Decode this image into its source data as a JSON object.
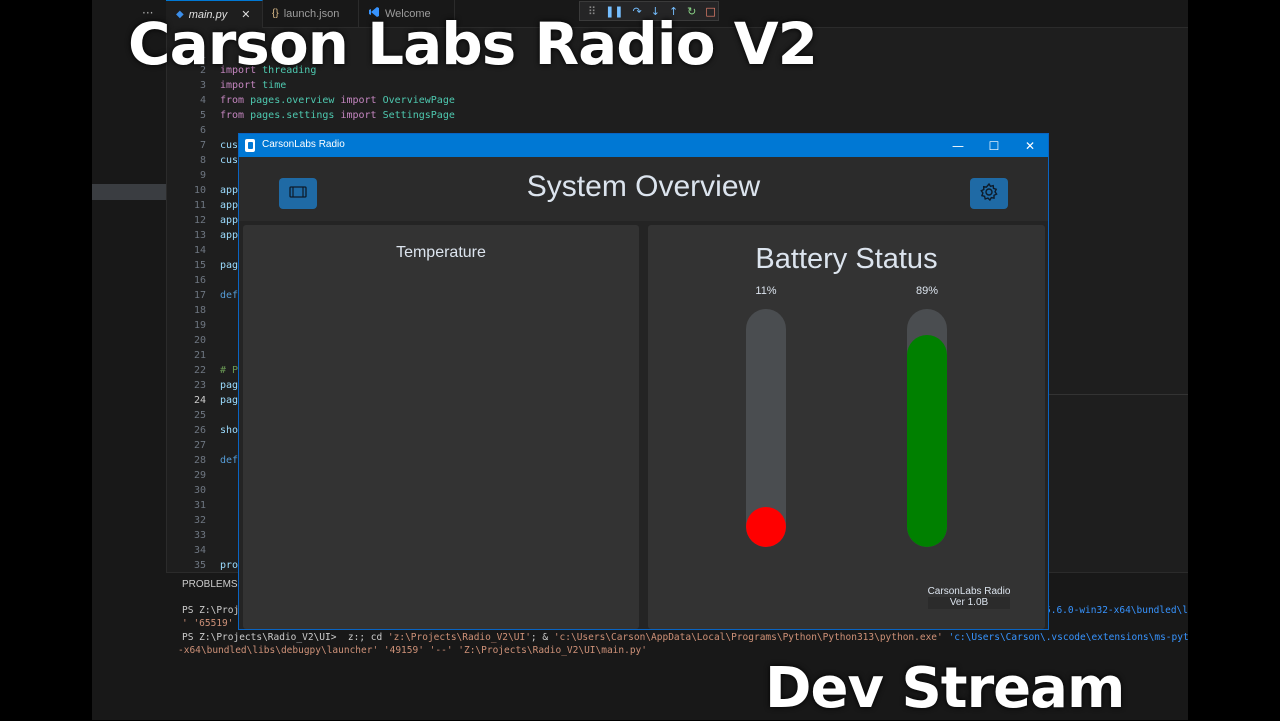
{
  "overlay": {
    "title": "Carson Labs Radio V2",
    "subtitle": "Dev Stream"
  },
  "editor": {
    "more_label": "···",
    "tabs": [
      {
        "label": "main.py",
        "icon": "python-file-icon",
        "active": true,
        "close": "✕"
      },
      {
        "label": "launch.json",
        "icon": "json-file-icon",
        "active": false
      },
      {
        "label": "Welcome",
        "icon": "vscode-logo-icon",
        "active": false
      }
    ],
    "line_numbers": [
      "1",
      "2",
      "3",
      "4",
      "5",
      "6",
      "7",
      "8",
      "9",
      "10",
      "11",
      "12",
      "13",
      "14",
      "15",
      "16",
      "17",
      "18",
      "19",
      "20",
      "21",
      "22",
      "23",
      "24",
      "25",
      "26",
      "27",
      "28",
      "29",
      "30",
      "31",
      "32",
      "33",
      "34",
      "35"
    ],
    "current_line": "24",
    "code": {
      "l2_kw": "import",
      "l2_mod": "threading",
      "l3_kw": "import",
      "l3_mod": "time",
      "l4_from": "from",
      "l4_mod": "pages.overview",
      "l4_imp": "import",
      "l4_name": "OverviewPage",
      "l5_from": "from",
      "l5_mod": "pages.settings",
      "l5_imp": "import",
      "l5_name": "SettingsPage",
      "l7": "cus",
      "l8": "cus",
      "l10": "app",
      "l11": "app",
      "l12": "app",
      "l13": "app",
      "l15": "pag",
      "l17": "def",
      "l22": "# P",
      "l23": "pag",
      "l24": "pag",
      "l26": "sho",
      "l28": "def",
      "l35": "pro"
    },
    "panel": {
      "title": "PROBLEMS",
      "line1_prefix": "PS Z:\\Proje",
      "line1_right": "25.6.0-win32-x64\\bundled\\l",
      "line2": "' '65519'",
      "line3_prompt": "PS Z:\\Projects\\Radio_V2\\UI>",
      "line3_cmd": "  z:; cd ",
      "line3_s1": "'z:\\Projects\\Radio_V2\\UI'",
      "line3_mid": "; & ",
      "line3_s2": "'c:\\Users\\Carson\\AppData\\Local\\Programs\\Python\\Python313\\python.exe'",
      "line3_s3": " 'c:\\Users\\Carson\\.vscode\\extensions\\ms-python.de",
      "line4": "-x64\\bundled\\libs\\debugpy\\launcher' '49159' '--' 'Z:\\Projects\\Radio_V2\\UI\\main.py'"
    }
  },
  "window": {
    "title": "CarsonLabs Radio",
    "minimize": "—",
    "maximize": "☐",
    "close": "✕",
    "page_title": "System Overview",
    "left_button_icon": "film-icon",
    "right_button_icon": "gear-icon",
    "temperature": {
      "label": "Temperature"
    },
    "battery": {
      "title": "Battery Status",
      "bars": [
        {
          "label": "11%",
          "level": 0.11,
          "color": "#ff0000"
        },
        {
          "label": "89%",
          "level": 0.89,
          "color": "#008000"
        }
      ]
    },
    "app_name": "CarsonLabs Radio",
    "version": "Ver 1.0B"
  },
  "colors": {
    "accent": "#1f6aa5",
    "titlebar": "#0078d4",
    "battery_low": "#ff0000",
    "battery_high": "#008000"
  }
}
